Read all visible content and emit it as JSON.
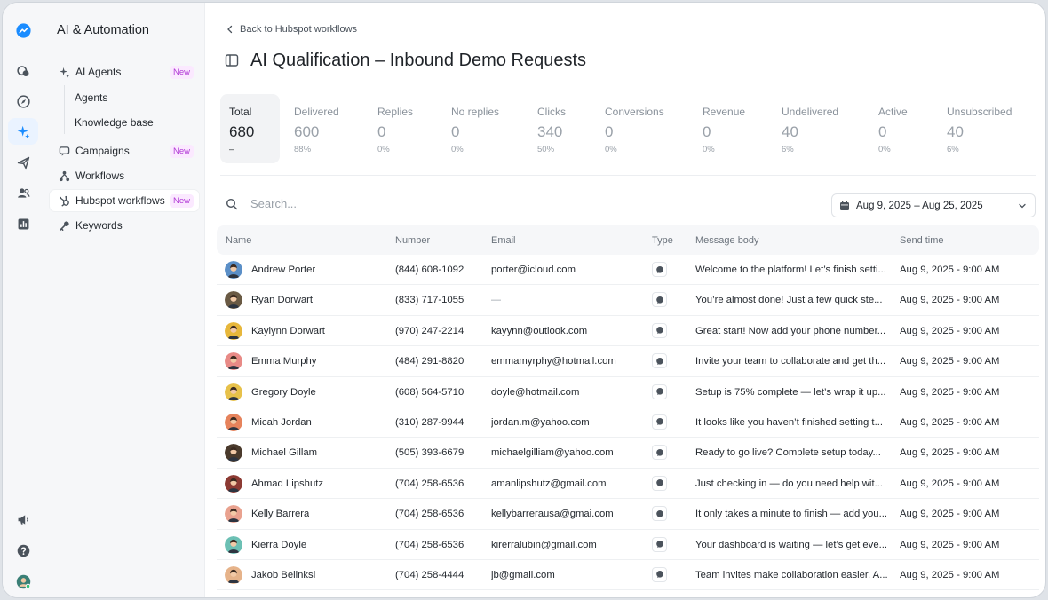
{
  "sidebar": {
    "title": "AI & Automation",
    "items": [
      {
        "label": "AI Agents",
        "badge": "New",
        "icon": "sparkle-icon"
      },
      {
        "label": "Agents"
      },
      {
        "label": "Knowledge base"
      },
      {
        "label": "Campaigns",
        "badge": "New",
        "icon": "chat-icon"
      },
      {
        "label": "Workflows",
        "icon": "workflow-icon"
      },
      {
        "label": "Hubspot workflows",
        "badge": "New",
        "icon": "hubspot-icon"
      },
      {
        "label": "Keywords",
        "icon": "key-icon"
      }
    ]
  },
  "header": {
    "back_label": "Back to Hubspot workflows",
    "title": "AI Qualification – Inbound Demo Requests"
  },
  "stats": [
    {
      "label": "Total",
      "value": "680",
      "pct": "–"
    },
    {
      "label": "Delivered",
      "value": "600",
      "pct": "88%"
    },
    {
      "label": "Replies",
      "value": "0",
      "pct": "0%"
    },
    {
      "label": "No replies",
      "value": "0",
      "pct": "0%"
    },
    {
      "label": "Clicks",
      "value": "340",
      "pct": "50%"
    },
    {
      "label": "Conversions",
      "value": "0",
      "pct": "0%"
    },
    {
      "label": "Revenue",
      "value": "0",
      "pct": "0%"
    },
    {
      "label": "Undelivered",
      "value": "40",
      "pct": "6%"
    },
    {
      "label": "Active",
      "value": "0",
      "pct": "0%"
    },
    {
      "label": "Unsubscribed",
      "value": "40",
      "pct": "6%"
    }
  ],
  "search": {
    "placeholder": "Search..."
  },
  "date_range": "Aug 9, 2025 – Aug 25, 2025",
  "table": {
    "columns": [
      "Name",
      "Number",
      "Email",
      "Type",
      "Message body",
      "Send time"
    ],
    "rows": [
      {
        "name": "Andrew Porter",
        "number": "(844) 608-1092",
        "email": "porter@icloud.com",
        "message": "Welcome to the platform! Let’s finish setti...",
        "time": "Aug 9, 2025 - 9:00 AM",
        "color": "#5b8fc7"
      },
      {
        "name": "Ryan Dorwart",
        "number": "(833) 717-1055",
        "email": "—",
        "message": "You’re almost done! Just a few quick ste...",
        "time": "Aug 9, 2025 - 9:00 AM",
        "color": "#6a5a44"
      },
      {
        "name": "Kaylynn Dorwart",
        "number": "(970) 247-2214",
        "email": "kayynn@outlook.com",
        "message": "Great start! Now add your phone number...",
        "time": "Aug 9, 2025 - 9:00 AM",
        "color": "#e7b73b"
      },
      {
        "name": "Emma Murphy",
        "number": "(484) 291-8820",
        "email": "emmamyrphy@hotmail.com",
        "message": "Invite your team to collaborate and get th...",
        "time": "Aug 9, 2025 - 9:00 AM",
        "color": "#e88a86"
      },
      {
        "name": "Gregory Doyle",
        "number": "(608) 564-5710",
        "email": "doyle@hotmail.com",
        "message": "Setup is 75% complete — let’s wrap it up...",
        "time": "Aug 9, 2025 - 9:00 AM",
        "color": "#e7c14a"
      },
      {
        "name": "Micah Jordan",
        "number": "(310) 287-9944",
        "email": "jordan.m@yahoo.com",
        "message": "It looks like you haven’t finished setting t...",
        "time": "Aug 9, 2025 - 9:00 AM",
        "color": "#e6835c"
      },
      {
        "name": "Michael Gillam",
        "number": "(505) 393-6679",
        "email": "michaelgilliam@yahoo.com",
        "message": "Ready to go live? Complete setup today...",
        "time": "Aug 9, 2025 - 9:00 AM",
        "color": "#4a3a2c"
      },
      {
        "name": "Ahmad Lipshutz",
        "number": "(704) 258-6536",
        "email": "amanlipshutz@gmail.com",
        "message": "Just checking in — do you need help wit...",
        "time": "Aug 9, 2025 - 9:00 AM",
        "color": "#8c3a33"
      },
      {
        "name": "Kelly Barrera",
        "number": "(704) 258-6536",
        "email": "kellybarrerausa@gmai.com",
        "message": "It only takes a minute to finish — add you...",
        "time": "Aug 9, 2025 - 9:00 AM",
        "color": "#e9a28f"
      },
      {
        "name": "Kierra Doyle",
        "number": "(704) 258-6536",
        "email": "kirerralubin@gmail.com",
        "message": "Your dashboard is waiting — let’s get eve...",
        "time": "Aug 9, 2025 - 9:00 AM",
        "color": "#6cc0b4"
      },
      {
        "name": "Jakob Belinksi",
        "number": "(704) 258-4444",
        "email": "jb@gmail.com",
        "message": "Team invites make collaboration easier. A...",
        "time": "Aug 9, 2025 - 9:00 AM",
        "color": "#e6b38a"
      }
    ]
  },
  "colors": {
    "brand": "#1a8cff",
    "badge_text": "#b23bd6",
    "badge_bg": "#fbe9ff",
    "online": "#2fbf71"
  }
}
